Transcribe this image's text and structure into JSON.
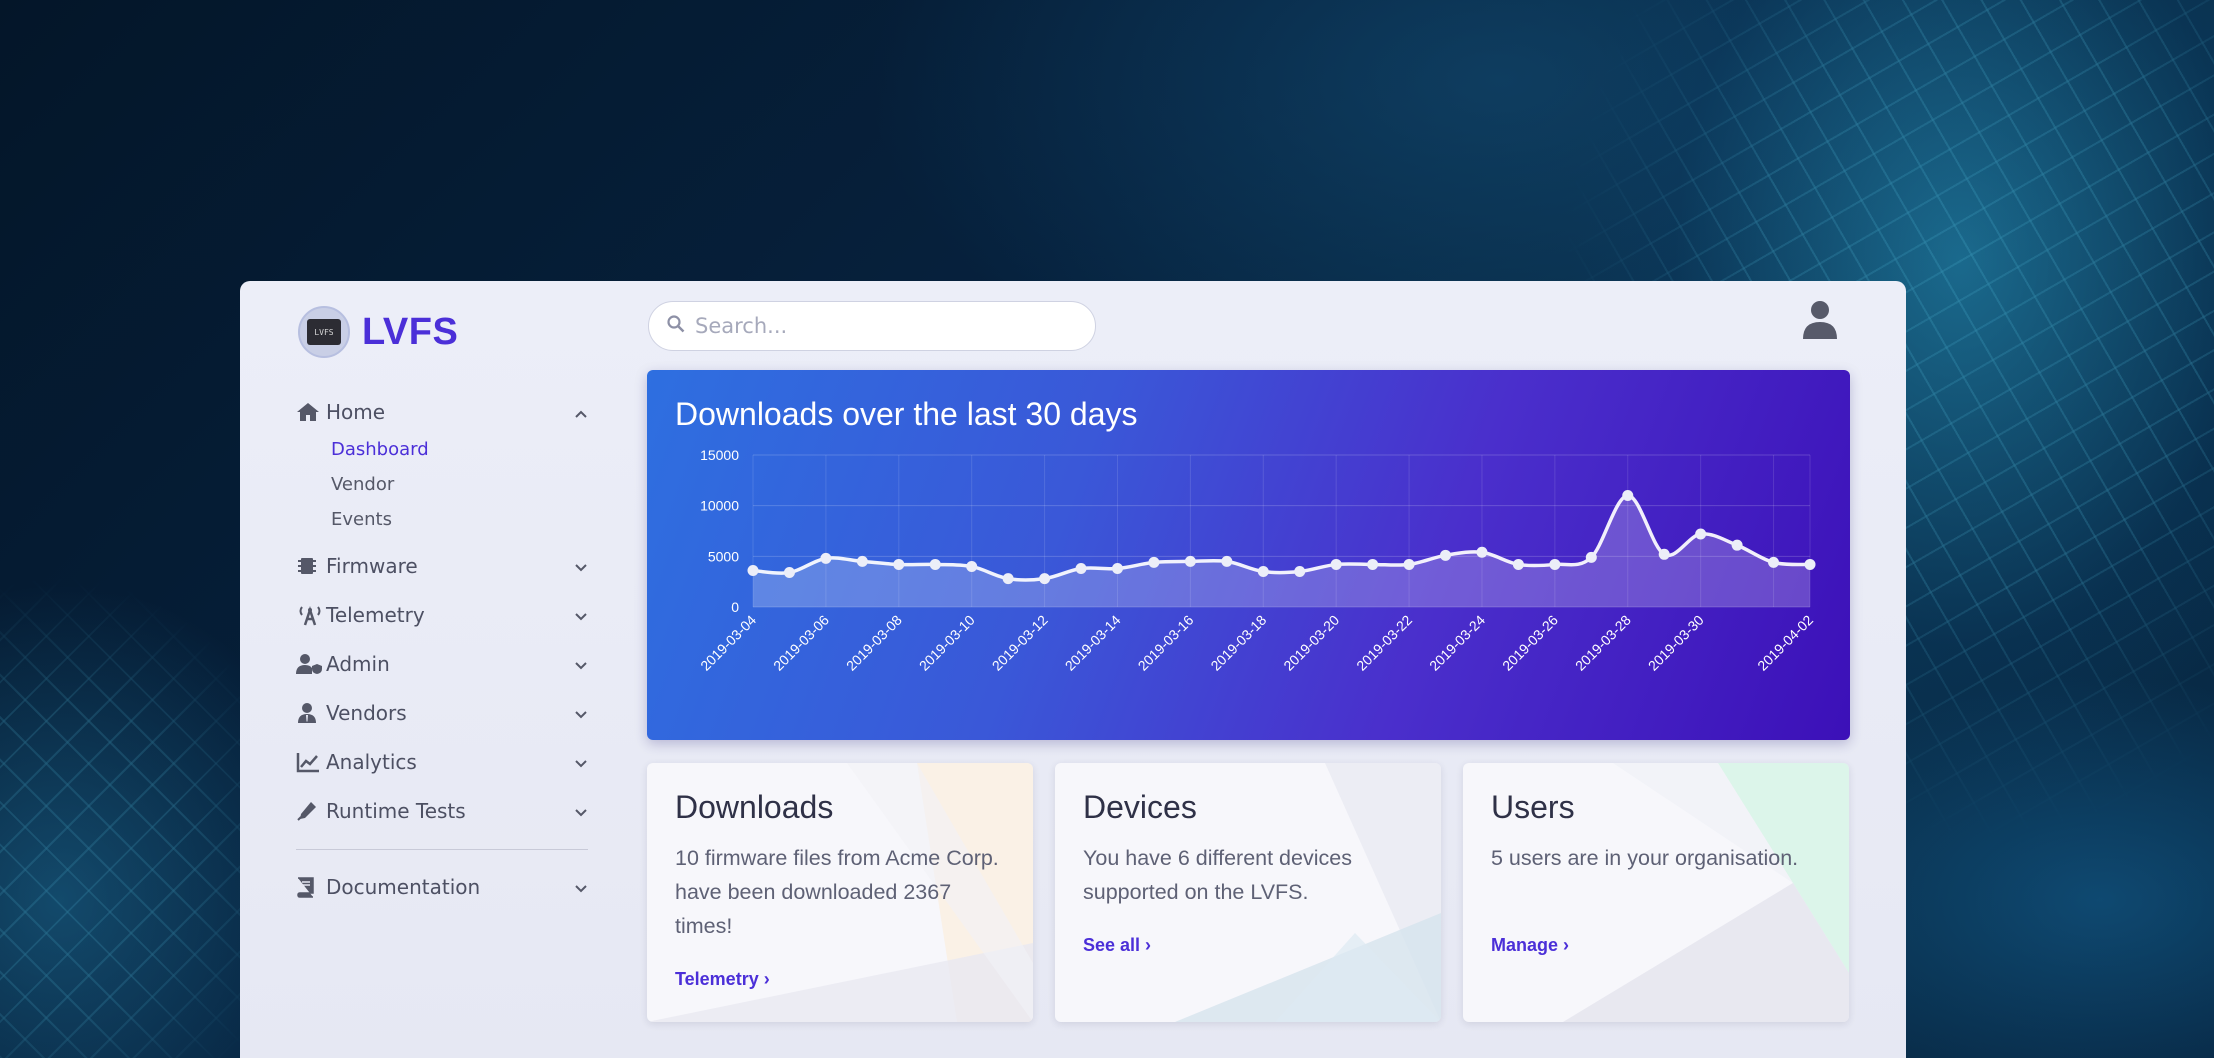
{
  "brand": {
    "name": "LVFS",
    "logo_text": "LVFS"
  },
  "search": {
    "placeholder": "Search..."
  },
  "nav": {
    "home": {
      "label": "Home",
      "sub": [
        "Dashboard",
        "Vendor",
        "Events"
      ]
    },
    "firmware": "Firmware",
    "telemetry": "Telemetry",
    "admin": "Admin",
    "vendors": "Vendors",
    "analytics": "Analytics",
    "runtime_tests": "Runtime Tests",
    "documentation": "Documentation"
  },
  "chart_card": {
    "title": "Downloads over the last 30 days"
  },
  "chart_data": {
    "type": "area",
    "title": "Downloads over the last 30 days",
    "x": [
      "2019-03-04",
      "2019-03-05",
      "2019-03-06",
      "2019-03-07",
      "2019-03-08",
      "2019-03-09",
      "2019-03-10",
      "2019-03-11",
      "2019-03-12",
      "2019-03-13",
      "2019-03-14",
      "2019-03-15",
      "2019-03-16",
      "2019-03-17",
      "2019-03-18",
      "2019-03-19",
      "2019-03-20",
      "2019-03-21",
      "2019-03-22",
      "2019-03-23",
      "2019-03-24",
      "2019-03-25",
      "2019-03-26",
      "2019-03-27",
      "2019-03-28",
      "2019-03-29",
      "2019-03-30",
      "2019-03-31",
      "2019-04-01",
      "2019-04-02"
    ],
    "xticks": [
      "2019-03-04",
      "2019-03-06",
      "2019-03-08",
      "2019-03-10",
      "2019-03-12",
      "2019-03-14",
      "2019-03-16",
      "2019-03-18",
      "2019-03-20",
      "2019-03-22",
      "2019-03-24",
      "2019-03-26",
      "2019-03-28",
      "2019-03-30",
      "2019-04-02"
    ],
    "values": [
      3600,
      3400,
      4800,
      4500,
      4200,
      4200,
      4000,
      2800,
      2800,
      3800,
      3800,
      4400,
      4500,
      4500,
      3500,
      3500,
      4200,
      4200,
      4200,
      5100,
      5400,
      4200,
      4200,
      4900,
      11000,
      5200,
      7200,
      6100,
      4400,
      4200
    ],
    "yticks": [
      0,
      5000,
      10000,
      15000
    ],
    "ylim": [
      0,
      15000
    ],
    "grid": true
  },
  "cards": {
    "downloads": {
      "title": "Downloads",
      "text": "10 firmware files from Acme Corp. have been downloaded 2367 times!",
      "link": "Telemetry ›"
    },
    "devices": {
      "title": "Devices",
      "text": "You have 6 different devices supported on the LVFS.",
      "link": "See all ›"
    },
    "users": {
      "title": "Users",
      "text": "5 users are in your organisation.",
      "link": "Manage ›"
    }
  },
  "colors": {
    "accent": "#4b2fd8",
    "chart_start": "#2e6fe0",
    "chart_end": "#3c10b8"
  }
}
